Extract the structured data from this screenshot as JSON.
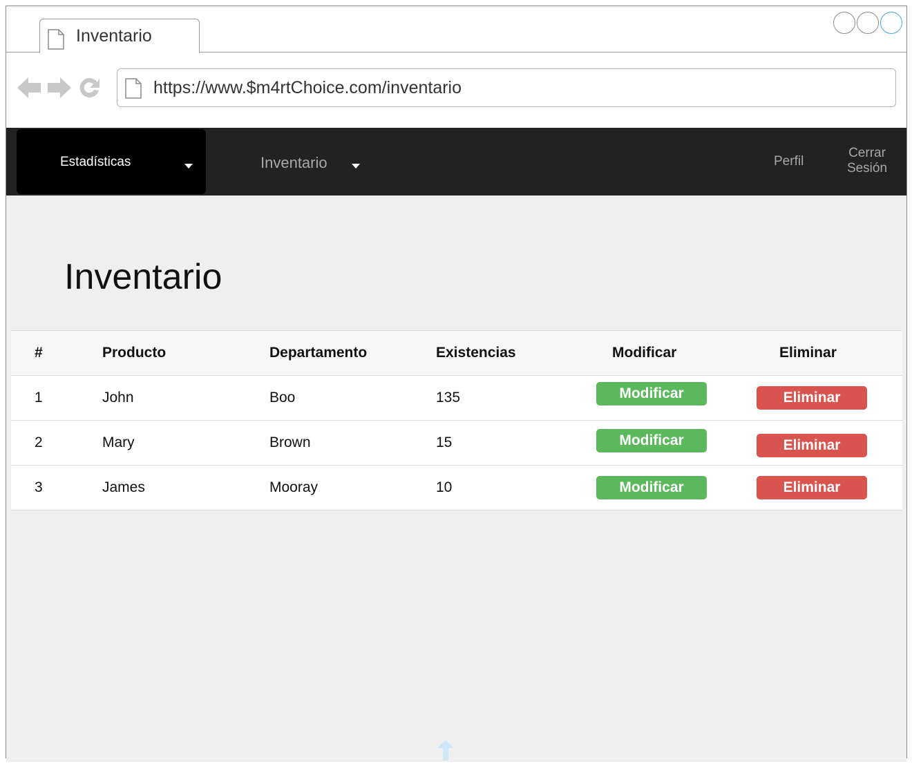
{
  "browser": {
    "tab_title": "Inventario",
    "url": "https://www.$m4rtChoice.com/inventario"
  },
  "nav": {
    "stats_label": "Estadísticas",
    "inventory_label": "Inventario",
    "profile_label": "Perfil",
    "logout_line1": "Cerrar",
    "logout_line2": "Sesión"
  },
  "page": {
    "title": "Inventario"
  },
  "table": {
    "headers": [
      "#",
      "Producto",
      "Departamento",
      "Existencias",
      "Modificar",
      "Eliminar"
    ],
    "rows": [
      {
        "num": "1",
        "product": "John",
        "department": "Boo",
        "stock": "135",
        "modify": "Modificar",
        "delete": "Eliminar"
      },
      {
        "num": "2",
        "product": "Mary",
        "department": "Brown",
        "stock": "15",
        "modify": "Modificar",
        "delete": "Eliminar"
      },
      {
        "num": "3",
        "product": "James",
        "department": "Mooray",
        "stock": "10",
        "modify": "Modificar",
        "delete": "Eliminar"
      }
    ]
  },
  "colors": {
    "nav_bg": "#222222",
    "nav_active_bg": "#000000",
    "content_bg": "#efefef",
    "modify_button": "#5cb85c",
    "delete_button": "#d9534f"
  }
}
